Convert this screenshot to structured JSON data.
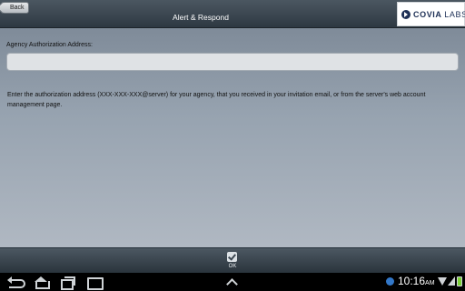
{
  "header": {
    "back_label": "Back",
    "title": "Alert & Respond",
    "logo_name": "covia-labs-logo",
    "logo_text_bold": "COVIA",
    "logo_text_light": "LABS"
  },
  "form": {
    "field_label": "Agency Authorization Address:",
    "field_value": "",
    "help_text": "Enter the authorization address (XXX-XXX-XXX@server) for your agency, that you received in your invitation email, or from the server's web account management page."
  },
  "footer": {
    "ok_label": "OK"
  },
  "system_bar": {
    "time": "10:16",
    "ampm": "AM"
  },
  "icons": {
    "back": "back-arrow-icon",
    "ok": "checkmark-icon",
    "nav_back": "nav-back-icon",
    "nav_home": "nav-home-icon",
    "nav_recent": "nav-recent-apps-icon",
    "nav_screenshot": "screenshot-icon",
    "nav_up": "chevron-up-icon",
    "wifi": "wifi-icon",
    "signal": "signal-icon",
    "battery": "battery-icon"
  },
  "colors": {
    "header_bg": "#3a4650",
    "content_bg_top": "#7f8b99",
    "content_bg_bottom": "#b0b8c2",
    "battery": "#7bd235"
  }
}
